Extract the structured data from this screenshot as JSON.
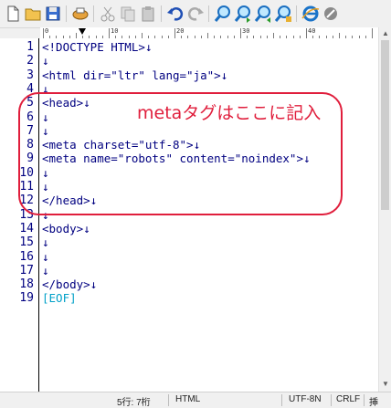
{
  "toolbar": {
    "icons": [
      "new-file-icon",
      "open-folder-icon",
      "save-icon",
      "print-icon",
      "cut-icon",
      "copy-icon",
      "paste-icon",
      "undo-icon",
      "redo-icon",
      "search-icon",
      "search-next-icon",
      "search-prev-icon",
      "replace-icon",
      "browser-icon",
      "settings-icon"
    ]
  },
  "ruler": {
    "labels": [
      "0",
      "10",
      "20",
      "30",
      "40"
    ],
    "caret_column": 7
  },
  "editor": {
    "lines": [
      {
        "num": "1",
        "text": "<!DOCTYPE HTML>↓"
      },
      {
        "num": "2",
        "text": "↓"
      },
      {
        "num": "3",
        "text": "<html dir=\"ltr\" lang=\"ja\">↓"
      },
      {
        "num": "4",
        "text": "↓"
      },
      {
        "num": "5",
        "text": "<head>↓"
      },
      {
        "num": "6",
        "text": "↓"
      },
      {
        "num": "7",
        "text": "↓"
      },
      {
        "num": "8",
        "text": "<meta charset=\"utf-8\">↓"
      },
      {
        "num": "9",
        "text": "<meta name=\"robots\" content=\"noindex\">↓"
      },
      {
        "num": "10",
        "text": "↓"
      },
      {
        "num": "11",
        "text": "↓"
      },
      {
        "num": "12",
        "text": "</head>↓"
      },
      {
        "num": "13",
        "text": "↓"
      },
      {
        "num": "14",
        "text": "<body>↓"
      },
      {
        "num": "15",
        "text": "↓"
      },
      {
        "num": "16",
        "text": "↓"
      },
      {
        "num": "17",
        "text": "↓"
      },
      {
        "num": "18",
        "text": "</body>↓"
      },
      {
        "num": "19",
        "text": "[EOF]"
      }
    ]
  },
  "annotation": {
    "text": "metaタグはここに記入",
    "color": "#e01e3c"
  },
  "status": {
    "position": "5行:  7桁",
    "mode": "HTML",
    "encoding": "UTF-8N",
    "newline": "CRLF",
    "insert": "挿"
  }
}
